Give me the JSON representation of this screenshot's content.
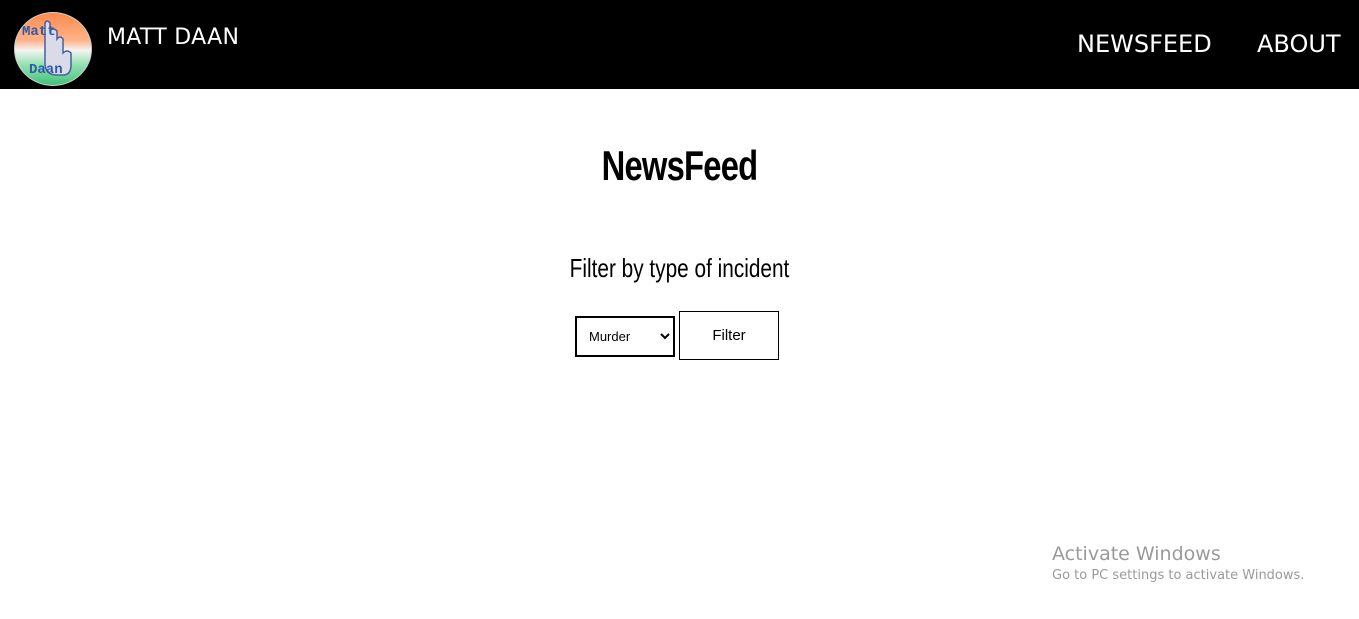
{
  "header": {
    "logo_text_top": "Matt",
    "logo_text_bottom": "Daan",
    "brand": "MATT DAAN",
    "nav": {
      "newsfeed": "NEWSFEED",
      "about": "ABOUT"
    }
  },
  "main": {
    "title": "NewsFeed",
    "filter_heading": "Filter by type of incident",
    "incident_select": {
      "selected": "Murder"
    },
    "filter_button": "Filter"
  },
  "watermark": {
    "title": "Activate Windows",
    "subtitle": "Go to PC settings to activate Windows."
  },
  "colors": {
    "navbar_bg": "#000000",
    "nav_text": "#ffffff",
    "watermark_text": "#9a9a9a"
  }
}
